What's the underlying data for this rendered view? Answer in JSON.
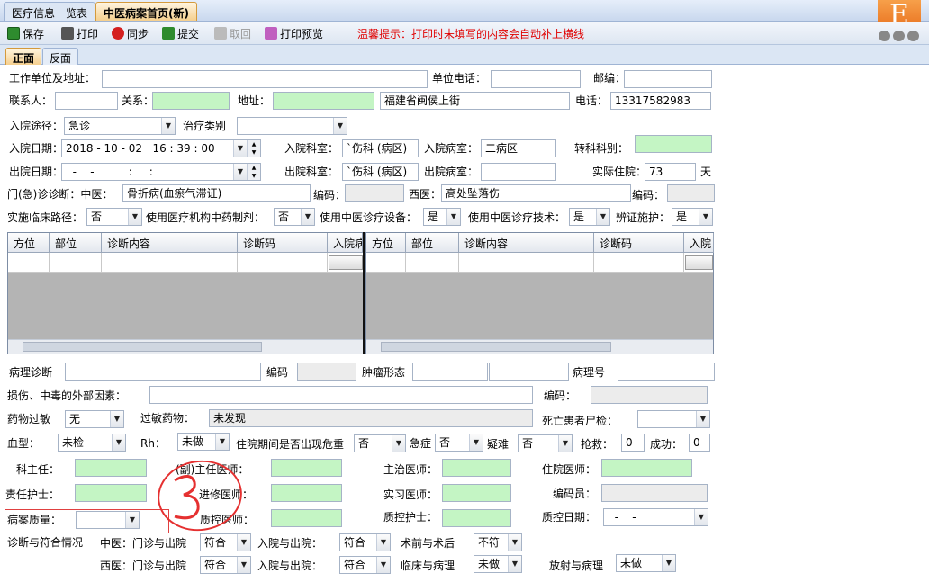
{
  "window_tabs": [
    "医疗信息一览表",
    "中医病案首页(新)"
  ],
  "logo_letter": "E",
  "toolbar": {
    "save": "保存",
    "print": "打印",
    "sync": "同步",
    "submit": "提交",
    "undo": "取回",
    "preview": "打印预览",
    "tip": "温馨提示：打印时未填写的内容会自动补上横线"
  },
  "form_tabs": [
    "正面",
    "反面"
  ],
  "row1": {
    "work_addr": "工作单位及地址：",
    "work_phone": "单位电话：",
    "postcode": "邮编："
  },
  "row2": {
    "contact": "联系人：",
    "relation": "关系：",
    "address": "地址：",
    "address_value": "福建省闽侯上街",
    "phone": "电话：",
    "phone_value": "13317582983"
  },
  "row3": {
    "route": "入院途径：",
    "route_value": "急诊",
    "treat_type": "治疗类别"
  },
  "row4": {
    "adm_date": "入院日期：",
    "adm_date_value": "2018 - 10 - 02   16 : 39 : 00",
    "adm_dept": "入院科室：",
    "adm_dept_value": "`伤科 (病区)",
    "adm_ward": "入院病室：",
    "adm_ward_value": "二病区",
    "transfer": "转科科别："
  },
  "row5": {
    "dis_date": "出院日期：",
    "dis_date_value": "  -    -          :     :",
    "dis_dept": "出院科室：",
    "dis_dept_value": "`伤科 (病区)",
    "dis_ward": "出院病室：",
    "stay": "实际住院：",
    "stay_value": "73",
    "stay_unit": "天"
  },
  "row6": {
    "outpatient": "门(急)诊诊断：中医：",
    "tcm_value": "骨折病(血瘀气滞证)",
    "code": "编码：",
    "western": "西医：",
    "western_value": "高处坠落伤",
    "code2": "编码："
  },
  "row7": {
    "pathway": "实施临床路径：",
    "pathway_value": "否",
    "tcm_prep": "使用医疗机构中药制剂：",
    "tcm_prep_value": "否",
    "tcm_equip": "使用中医诊疗设备：",
    "tcm_equip_value": "是",
    "tcm_tech": "使用中医诊疗技术：",
    "tcm_tech_value": "是",
    "syndrome": "辨证施护：",
    "syndrome_value": "是"
  },
  "grid_headers": [
    "方位",
    "部位",
    "诊断内容",
    "诊断码",
    "入院病"
  ],
  "grid_headers_right": [
    "方位",
    "部位",
    "诊断内容",
    "诊断码",
    "入院"
  ],
  "row8": {
    "pathology": "病理诊断",
    "code": "编码",
    "tumor": "肿瘤形态",
    "path_no": "病理号"
  },
  "row9": {
    "injury": "损伤、中毒的外部因素：",
    "code": "编码："
  },
  "row10": {
    "allergy": "药物过敏",
    "allergy_value": "无",
    "allergy_drug": "过敏药物：",
    "allergy_drug_value": "未发现",
    "autopsy": "死亡患者尸检："
  },
  "row11": {
    "blood": "血型：",
    "blood_value": "未检",
    "rh": "Rh：",
    "rh_value": "未做",
    "crisis": "住院期间是否出现危重",
    "crisis_value": "否",
    "acute": "急症",
    "acute_value": "否",
    "difficult": "疑难",
    "difficult_value": "否",
    "rescue": "抢救：",
    "rescue_value": "0",
    "success": "成功：",
    "success_value": "0"
  },
  "staff": {
    "dept_head": "科主任：",
    "assoc_chief": "(副)主任医师：",
    "attending": "主治医师：",
    "resident": "住院医师：",
    "nurse": "责任护士：",
    "trainee": "进修医师：",
    "intern": "实习医师：",
    "coder": "编码员：",
    "quality": "病案质量：",
    "qc_doctor": "质控医师：",
    "qc_nurse": "质控护士：",
    "qc_date": "质控日期：",
    "qc_date_value": "  -    -"
  },
  "annotation": "3",
  "diag": {
    "title": "诊断与符合情况",
    "tcm": "中医：门诊与出院",
    "tcm_v1": "符合",
    "adm_dis": "入院与出院：",
    "tcm_v2": "符合",
    "pre_post": "术前与术后",
    "pre_post_v": "不符",
    "wm": "西医：门诊与出院",
    "wm_v1": "符合",
    "adm_dis2": "入院与出院：",
    "wm_v2": "符合",
    "clin_path": "临床与病理",
    "clin_path_v": "未做",
    "rad_path": "放射与病理",
    "rad_path_v": "未做"
  },
  "colors": {
    "accent": "#e8701e",
    "green_field": "#c4f5c4",
    "tip_red": "#e00000",
    "annotation_red": "#e53030"
  }
}
